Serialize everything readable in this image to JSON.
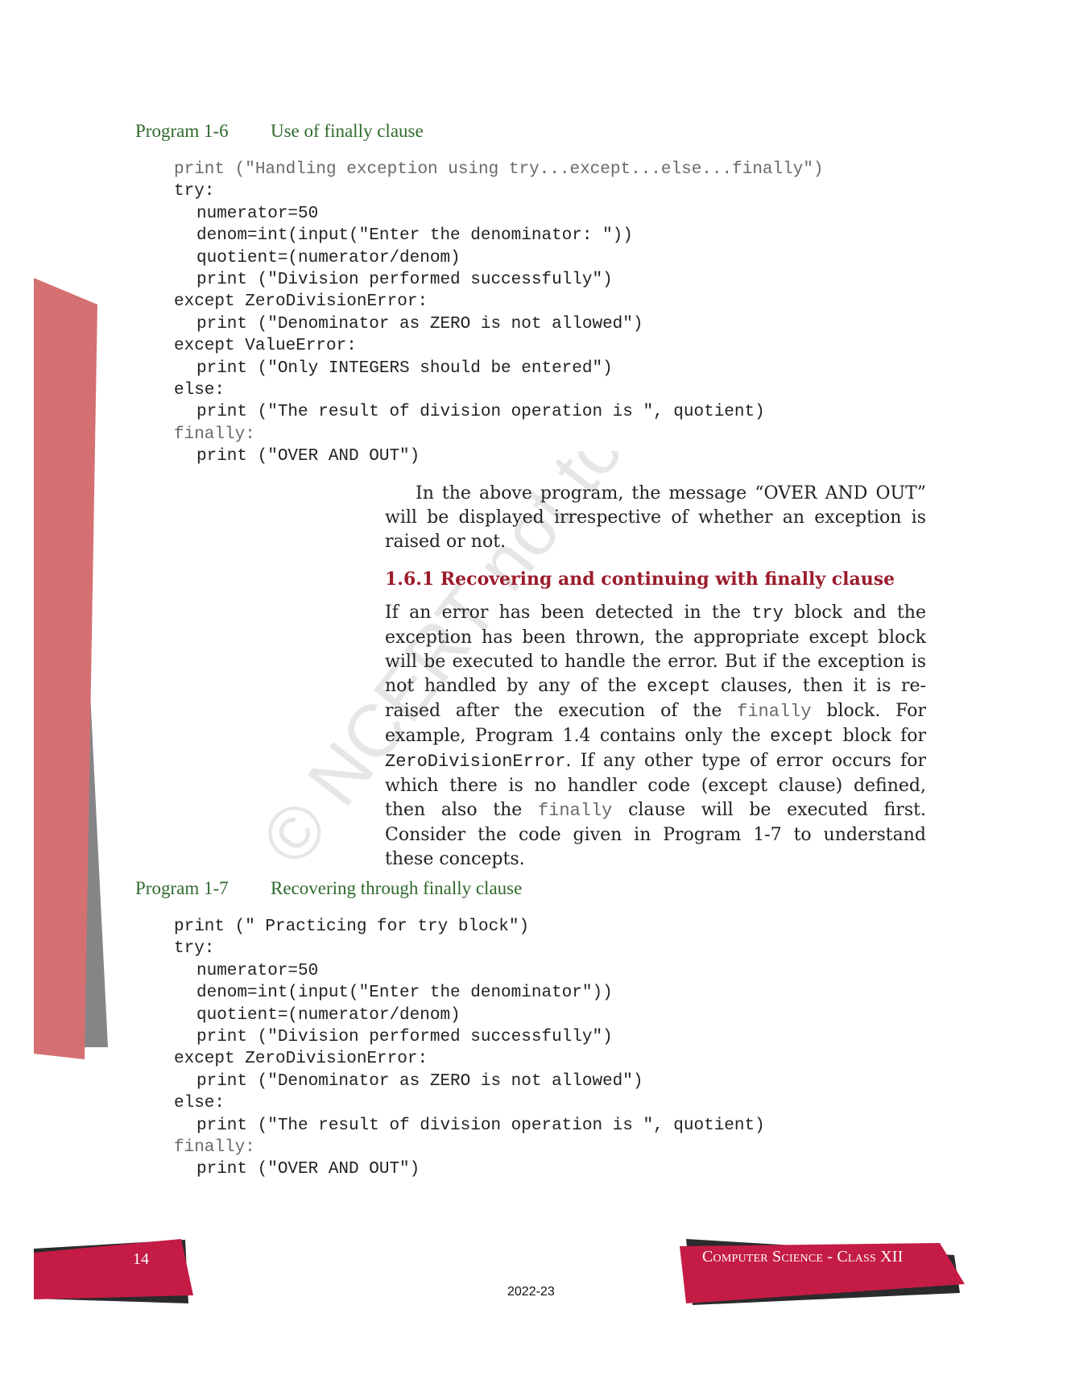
{
  "page": {
    "number": "14",
    "running_title": "Computer Science - Class XII",
    "year": "2022-23",
    "watermark": "© NCERT not to be republished",
    "colors": {
      "program_heading": "#2f6a2c",
      "section_heading": "#9b1c2c",
      "footer_red": "#c41c45",
      "sidebar_pink": "#d47072",
      "sidebar_gray": "#858587"
    }
  },
  "program_1_6": {
    "number": "Program 1-6",
    "title": "Use of finally clause",
    "lines": [
      "print (\"Handling exception using try...except...else...finally\")",
      "try:",
      "numerator=50",
      "denom=int(input(\"Enter the denominator: \"))",
      "quotient=(numerator/denom)",
      "print (\"Division performed successfully\")",
      "except ZeroDivisionError:",
      "print (\"Denominator as ZERO is not allowed\")",
      "except ValueError:",
      "print (\"Only INTEGERS should be entered\")",
      "else:",
      "print (\"The result of division operation is \", quotient)",
      "finally:",
      "print (\"OVER AND OUT\")"
    ]
  },
  "para1": "In the above program, the message “OVER AND OUT” will be displayed irrespective of whether an exception is raised or not.",
  "section": {
    "heading": "1.6.1 Recovering and continuing with finally clause",
    "p_parts": {
      "a": "If an error has been detected in the ",
      "try": "try",
      "b": " block and the exception has been thrown, the appropriate except block will be executed to handle the error. But if the exception is not handled by any of the ",
      "except": "except",
      "c": " clauses, then it is re-raised after the execution of the ",
      "finally": "finally",
      "d": " block. For example, Program 1.4 contains only the ",
      "except2": "except",
      "e": " block for ",
      "zde": "ZeroDivisionError",
      "f": ". If any other type of error occurs for which there is no handler code (except clause) defined, then also the ",
      "finally2": "finally",
      "g": " clause will be executed first. Consider the code given in Program 1-7 to understand these concepts."
    }
  },
  "program_1_7": {
    "number": "Program 1-7",
    "title": "Recovering through finally clause",
    "lines": [
      "print (\" Practicing for try block\")",
      "try:",
      "numerator=50",
      "denom=int(input(\"Enter the denominator\"))",
      "quotient=(numerator/denom)",
      "print (\"Division performed successfully\")",
      "except ZeroDivisionError:",
      "print (\"Denominator as ZERO is not allowed\")",
      "else:",
      "print (\"The result of division operation is \", quotient)",
      "finally:",
      "print (\"OVER AND OUT\")"
    ]
  }
}
